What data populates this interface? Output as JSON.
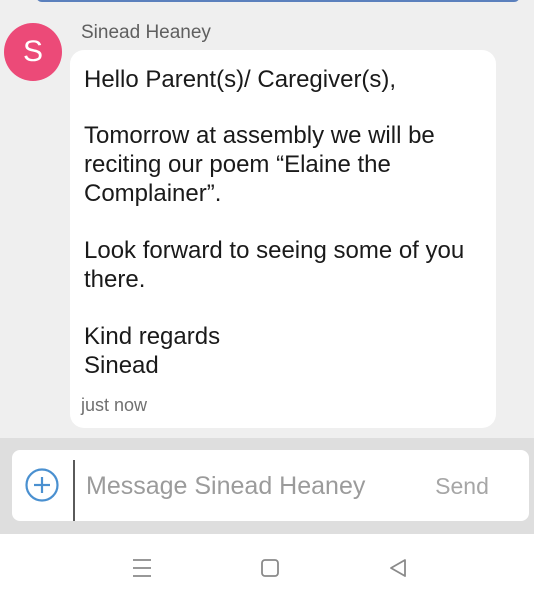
{
  "chat": {
    "sender_name": "Sinead Heaney",
    "avatar_initial": "S",
    "message_lines": [
      "Hello Parent(s)/ Caregiver(s),",
      "Tomorrow at assembly we will be",
      "reciting our poem “Elaine the",
      "Complainer”.",
      "Look forward to seeing some of you",
      "there.",
      "Kind regards",
      "Sinead"
    ],
    "timestamp": "just now"
  },
  "composer": {
    "placeholder": "Message Sinead Heaney",
    "value": "",
    "send_label": "Send",
    "add_icon": "plus-circle-icon"
  },
  "navbar": {
    "icons": [
      "menu-icon",
      "home-icon",
      "back-icon"
    ]
  },
  "colors": {
    "avatar": "#ec4a78",
    "add_icon": "#4a90d0",
    "top_strip": "#5b80bd"
  }
}
